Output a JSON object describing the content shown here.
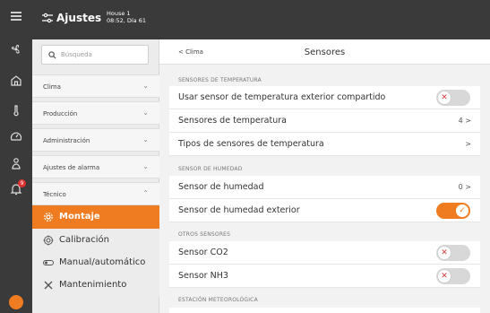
{
  "topbar": {
    "title": "Ajustes",
    "house_name": "House 1",
    "house_time": "08:52, Día 61"
  },
  "sidebar": {
    "search_placeholder": "Búsqueda",
    "menu": [
      {
        "label": "Clima",
        "chevron": "⌄"
      },
      {
        "label": "Producción",
        "chevron": "⌄"
      },
      {
        "label": "Administración",
        "chevron": "⌄"
      },
      {
        "label": "Ajustes de alarma",
        "chevron": "⌄"
      },
      {
        "label": "Técnico",
        "chevron": "⌃"
      }
    ],
    "submenu": [
      {
        "label": "Montaje",
        "icon": "gear-icon",
        "active": true
      },
      {
        "label": "Calibración",
        "icon": "target-icon"
      },
      {
        "label": "Manual/automático",
        "icon": "toggle-icon"
      },
      {
        "label": "Mantenimiento",
        "icon": "tools-icon"
      }
    ]
  },
  "rail": {
    "alarm_count": "9"
  },
  "main": {
    "back": "< Clima",
    "title": "Sensores",
    "sections": {
      "temp": "SENSORES DE TEMPERATURA",
      "hum": "SENSOR DE HUMEDAD",
      "other": "OTROS SENSORES",
      "weather": "ESTACIÓN METEOROLÓGICA"
    },
    "rows": {
      "shared_outdoor": "Usar sensor de temperatura exterior compartido",
      "temp_sensors": "Sensores de temperatura",
      "temp_sensors_value": "4 >",
      "temp_types": "Tipos de sensores de temperatura",
      "temp_types_value": ">",
      "hum_sensor": "Sensor de humedad",
      "hum_sensor_value": "0 >",
      "hum_outdoor": "Sensor de humedad exterior",
      "co2": "Sensor CO2",
      "nh3": "Sensor NH3"
    },
    "toggle_off_glyph": "✕",
    "toggle_on_glyph": "✓"
  },
  "colors": {
    "accent": "#f07c22",
    "dark": "#3a3a3a",
    "off_x": "#d93a3a"
  }
}
